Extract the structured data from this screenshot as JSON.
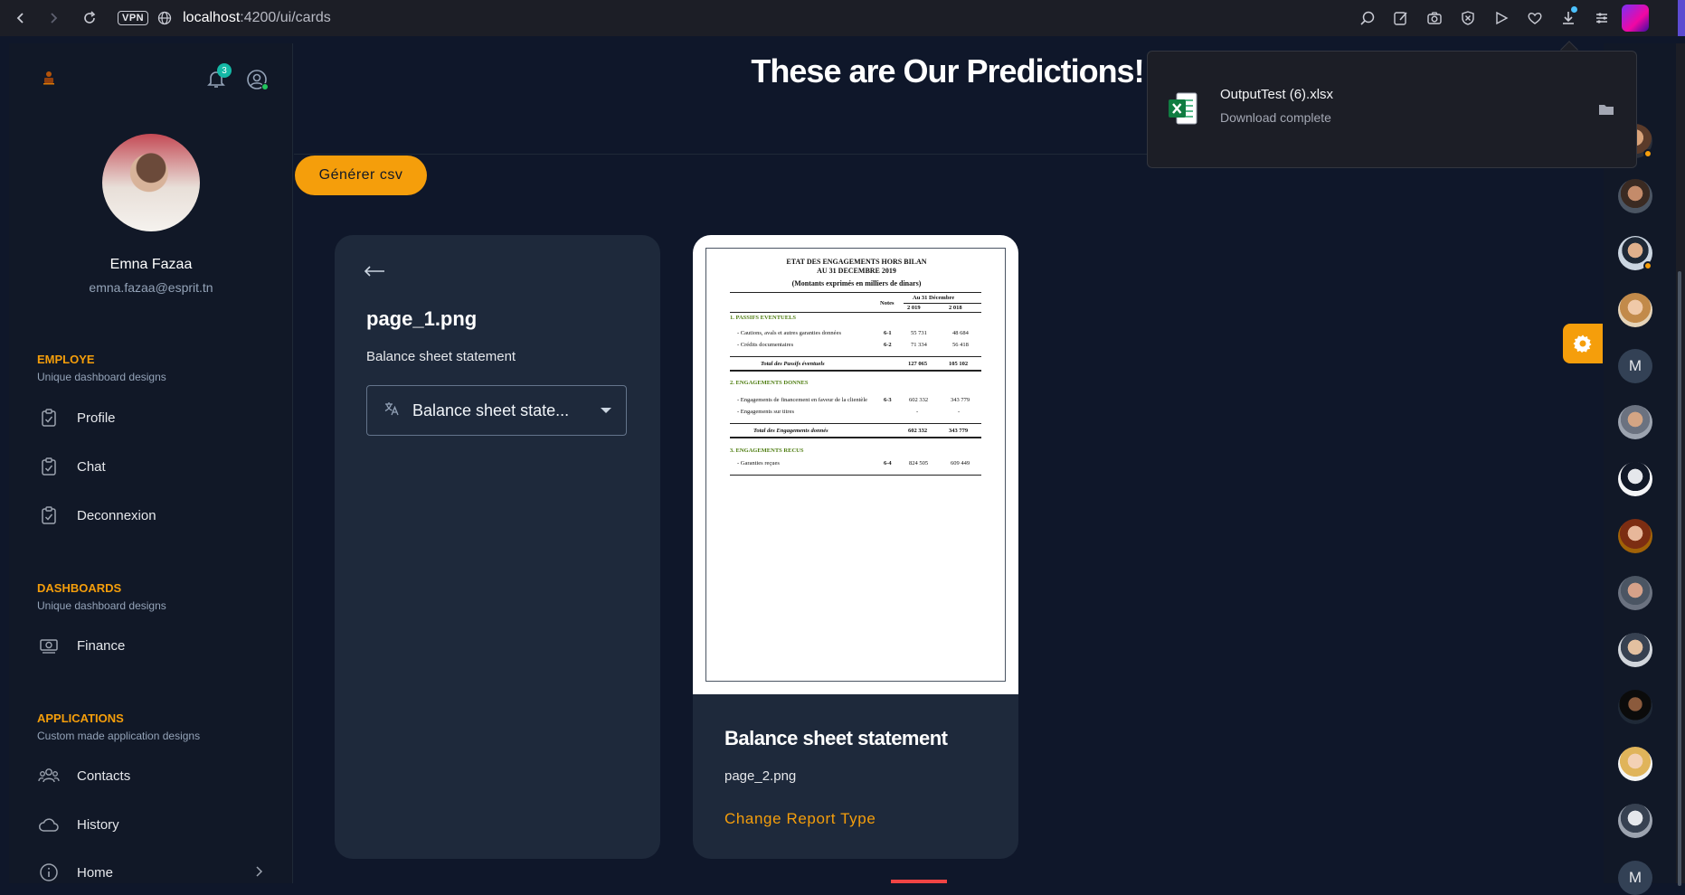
{
  "browser": {
    "url_host": "localhost",
    "url_path": ":4200/ui/cards",
    "vpn_label": "VPN"
  },
  "download": {
    "file_name": "OutputTest (6).xlsx",
    "status": "Download complete"
  },
  "sidebar": {
    "notification_count": "3",
    "profile": {
      "name": "Emna Fazaa",
      "email": "emna.fazaa@esprit.tn"
    },
    "sections": [
      {
        "title": "EMPLOYE",
        "subtitle": "Unique dashboard designs",
        "items": [
          {
            "label": "Profile"
          },
          {
            "label": "Chat"
          },
          {
            "label": "Deconnexion"
          }
        ]
      },
      {
        "title": "DASHBOARDS",
        "subtitle": "Unique dashboard designs",
        "items": [
          {
            "label": "Finance"
          }
        ]
      },
      {
        "title": "APPLICATIONS",
        "subtitle": "Custom made application designs",
        "items": [
          {
            "label": "Contacts"
          },
          {
            "label": "History"
          },
          {
            "label": "Home"
          }
        ]
      }
    ]
  },
  "main": {
    "title": "These are Our Predictions!",
    "csv_button": "Générer csv",
    "back_card": {
      "file_name": "page_1.png",
      "report_type": "Balance sheet statement",
      "select_value": "Balance sheet state..."
    },
    "front_card": {
      "title": "Balance sheet statement",
      "file_name": "page_2.png",
      "link": "Change Report Type"
    },
    "document": {
      "heading1": "ETAT DES ENGAGEMENTS HORS BILAN",
      "heading2": "AU 31 DECEMBRE 2019",
      "heading3": "(Montants exprimés en milliers de dinars)",
      "col_notes": "Notes",
      "col_group": "Au 31 Décembre",
      "col_2019": "2 019",
      "col_2018": "2 018",
      "sec1": "1. PASSIFS EVENTUELS",
      "r1_label": "- Cautions, avals et autres garanties données",
      "r1_note": "6-1",
      "r1_a": "55 731",
      "r1_b": "48 684",
      "r2_label": "- Crédits documentaires",
      "r2_note": "6-2",
      "r2_a": "71 334",
      "r2_b": "56 418",
      "t1_label": "Total des Passifs éventuels",
      "t1_a": "127 065",
      "t1_b": "105 102",
      "sec2": "2. ENGAGEMENTS DONNES",
      "r3_label": "- Engagements de financement en faveur de la clientèle",
      "r3_note": "6-3",
      "r3_a": "602 332",
      "r3_b": "343 779",
      "r4_label": "- Engagements sur titres",
      "r4_a": "-",
      "r4_b": "-",
      "t2_label": "Total des Engagements donnés",
      "t2_a": "602 332",
      "t2_b": "343 779",
      "sec3": "3. ENGAGEMENTS RECUS",
      "r5_label": "- Garanties reçues",
      "r5_note": "6-4",
      "r5_a": "824 505",
      "r5_b": "609 449"
    }
  },
  "rail": {
    "letter_contact": "M",
    "letter_contact_2": "M"
  },
  "colors": {
    "accent": "#f59e0b",
    "background": "#0f172a",
    "card": "#1e293b",
    "online": "#22c55e",
    "badge": "#14b8a6"
  }
}
